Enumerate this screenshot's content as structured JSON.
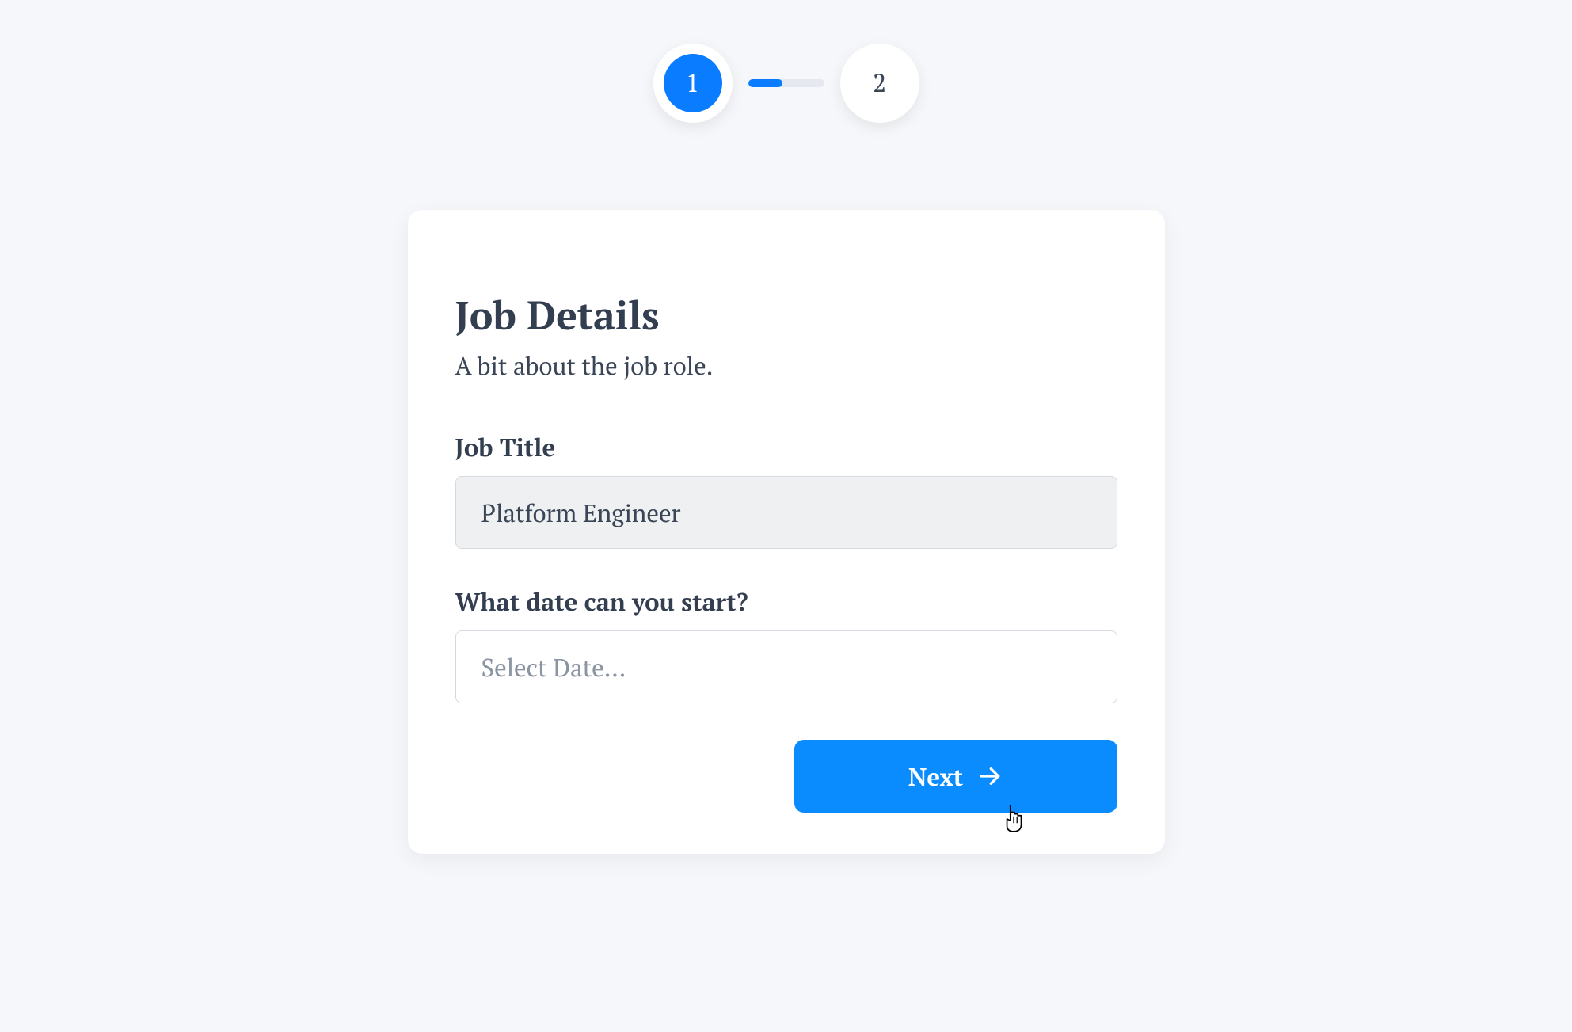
{
  "stepper": {
    "steps": [
      {
        "label": "1",
        "active": true
      },
      {
        "label": "2",
        "active": false
      }
    ],
    "progress_fill_percent": 45
  },
  "card": {
    "title": "Job Details",
    "subtitle": "A bit about the job role.",
    "fields": {
      "job_title": {
        "label": "Job Title",
        "value": "Platform Engineer"
      },
      "start_date": {
        "label": "What date can you start?",
        "placeholder": "Select Date..."
      }
    },
    "next_button_label": "Next"
  },
  "colors": {
    "primary": "#0a7cff",
    "button": "#0a8cff",
    "text_dark": "#333e51",
    "text_body": "#3a4556",
    "placeholder": "#8a94a2",
    "background": "#f5f7fa",
    "card_bg": "#ffffff",
    "input_border": "#d6dae0",
    "input_readonly_bg": "#eff0f2",
    "connector_bg": "#e5e8ee"
  }
}
